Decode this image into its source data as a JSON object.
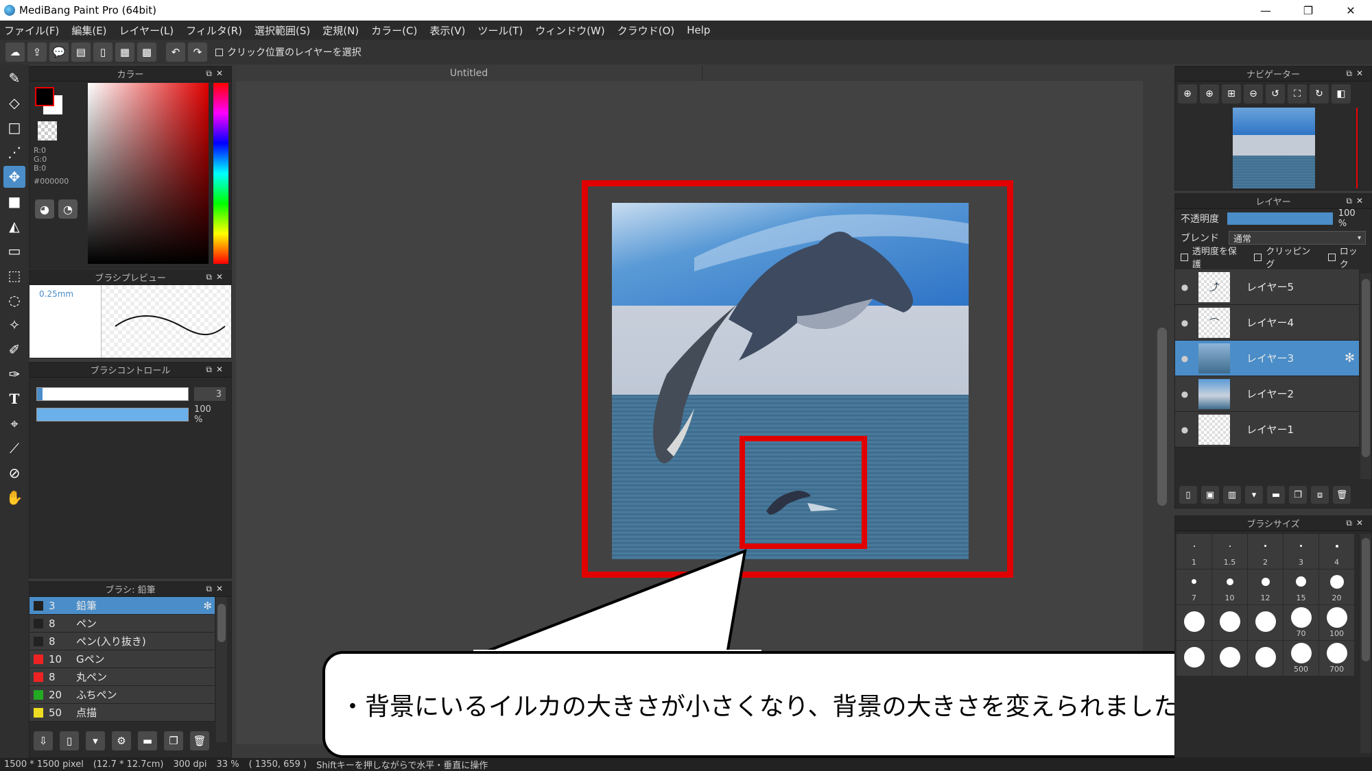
{
  "window": {
    "title": "MediBang Paint Pro (64bit)",
    "minimize": "—",
    "restore": "❐",
    "close": "✕"
  },
  "menu": [
    "ファイル(F)",
    "編集(E)",
    "レイヤー(L)",
    "フィルタ(R)",
    "選択範囲(S)",
    "定規(N)",
    "カラー(C)",
    "表示(V)",
    "ツール(T)",
    "ウィンドウ(W)",
    "クラウド(O)",
    "Help"
  ],
  "toolbar": {
    "select_by_click_label": "クリック位置のレイヤーを選択"
  },
  "color_panel": {
    "title": "カラー",
    "r": "R:0",
    "g": "G:0",
    "b": "B:0",
    "hex": "#000000",
    "foreground": "#000000",
    "background": "#ffffff"
  },
  "brush_preview": {
    "title": "ブラシプレビュー",
    "size_label": "0.25mm"
  },
  "brush_control": {
    "title": "ブラシコントロール",
    "size_value": "3",
    "opacity_value": "100 %"
  },
  "brush_list": {
    "title": "ブラシ: 鉛筆",
    "items": [
      {
        "size": "3",
        "name": "鉛筆",
        "color": "#222222"
      },
      {
        "size": "8",
        "name": "ペン",
        "color": "#222222"
      },
      {
        "size": "8",
        "name": "ペン(入り抜き)",
        "color": "#222222"
      },
      {
        "size": "10",
        "name": "Gペン",
        "color": "#ee2222"
      },
      {
        "size": "8",
        "name": "丸ペン",
        "color": "#ee2222"
      },
      {
        "size": "20",
        "name": "ふちペン",
        "color": "#22aa22"
      },
      {
        "size": "50",
        "name": "点描",
        "color": "#eedd22"
      }
    ]
  },
  "canvas": {
    "doc_title": "Untitled"
  },
  "callout": {
    "text": "・背景にいるイルカの大きさが小さくなり、背景の大きさを変えられました"
  },
  "navigator": {
    "title": "ナビゲーター"
  },
  "layer_panel": {
    "title": "レイヤー",
    "opacity_label": "不透明度",
    "opacity_value": "100 %",
    "opacity_percent": 100,
    "blend_label": "ブレンド",
    "blend_value": "通常",
    "protect_label": "透明度を保護",
    "clipping_label": "クリッピング",
    "lock_label": "ロック",
    "layers": [
      {
        "name": "レイヤー5"
      },
      {
        "name": "レイヤー4"
      },
      {
        "name": "レイヤー3"
      },
      {
        "name": "レイヤー2"
      },
      {
        "name": "レイヤー1"
      }
    ]
  },
  "brush_size_panel": {
    "title": "ブラシサイズ",
    "sizes": [
      "1",
      "1.5",
      "2",
      "3",
      "4",
      "7",
      "10",
      "12",
      "15",
      "20",
      "",
      "",
      "",
      "70",
      "100",
      "",
      "",
      "",
      "500",
      "700"
    ]
  },
  "status": {
    "canvas_size": "1500 * 1500 pixel",
    "physical_size": "(12.7 * 12.7cm)",
    "dpi": "300 dpi",
    "zoom": "33 %",
    "cursor": "( 1350, 659 )",
    "hint": "Shiftキーを押しながらで水平・垂直に操作"
  }
}
